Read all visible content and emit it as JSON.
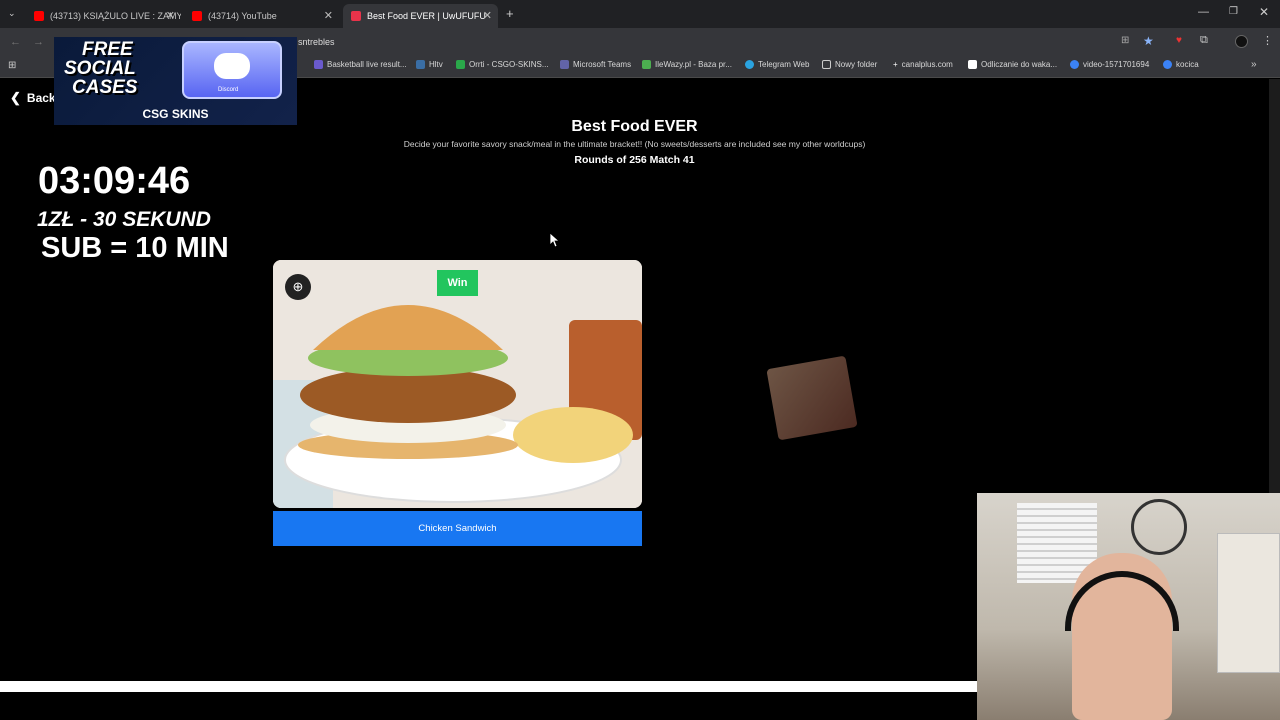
{
  "tabs": [
    {
      "title": "(43713) KSIĄŻULO LIVE : ZAMY",
      "favicon_color": "#ff0000"
    },
    {
      "title": "(43714) YouTube",
      "favicon_color": "#ff0000"
    },
    {
      "title": "Best Food EVER | UwUFUFU",
      "favicon_color": "#e8334a"
    }
  ],
  "address": {
    "url_fragment": "sntrebles"
  },
  "bookmarks": [
    {
      "label": "Basketball live result...",
      "color": "#6a5acd"
    },
    {
      "label": "Hltv",
      "color": "#3a6ea5"
    },
    {
      "label": "Orrti - CSGO-SKINS...",
      "color": "#2aa84a"
    },
    {
      "label": "Microsoft Teams",
      "color": "#6264a7"
    },
    {
      "label": "IleWazy.pl - Baza pr...",
      "color": "#4caf50"
    },
    {
      "label": "Telegram Web",
      "color": "#2aa3e0"
    },
    {
      "label": "Nowy folder",
      "color": "#cccccc"
    },
    {
      "label": "canalplus.com",
      "color": "#ffffff"
    },
    {
      "label": "Odliczanie do waka...",
      "color": "#ffffff"
    },
    {
      "label": "video-1571701694",
      "color": "#3b82f6"
    },
    {
      "label": "kocica",
      "color": "#3b82f6"
    }
  ],
  "overlay_ad": {
    "line1": "FREE",
    "line2": "SOCIAL",
    "line3": "CASES",
    "brand": "CSG SKINS",
    "badge": "Discord"
  },
  "back_label": "Back",
  "stream": {
    "timer": "03:09:46",
    "rate": "1ZŁ - 30 SEKUND",
    "sub": "SUB = 10 MIN"
  },
  "worldcup": {
    "title": "Best Food EVER",
    "description": "Decide your favorite savory snack/meal in the ultimate bracket!! (No sweets/desserts are included see my other worldcups)",
    "rounds": "Rounds of 256 Match 41",
    "win_label": "Win",
    "option_label": "Chicken Sandwich"
  },
  "colors": {
    "accent": "#1877f2",
    "win": "#22c55e"
  }
}
